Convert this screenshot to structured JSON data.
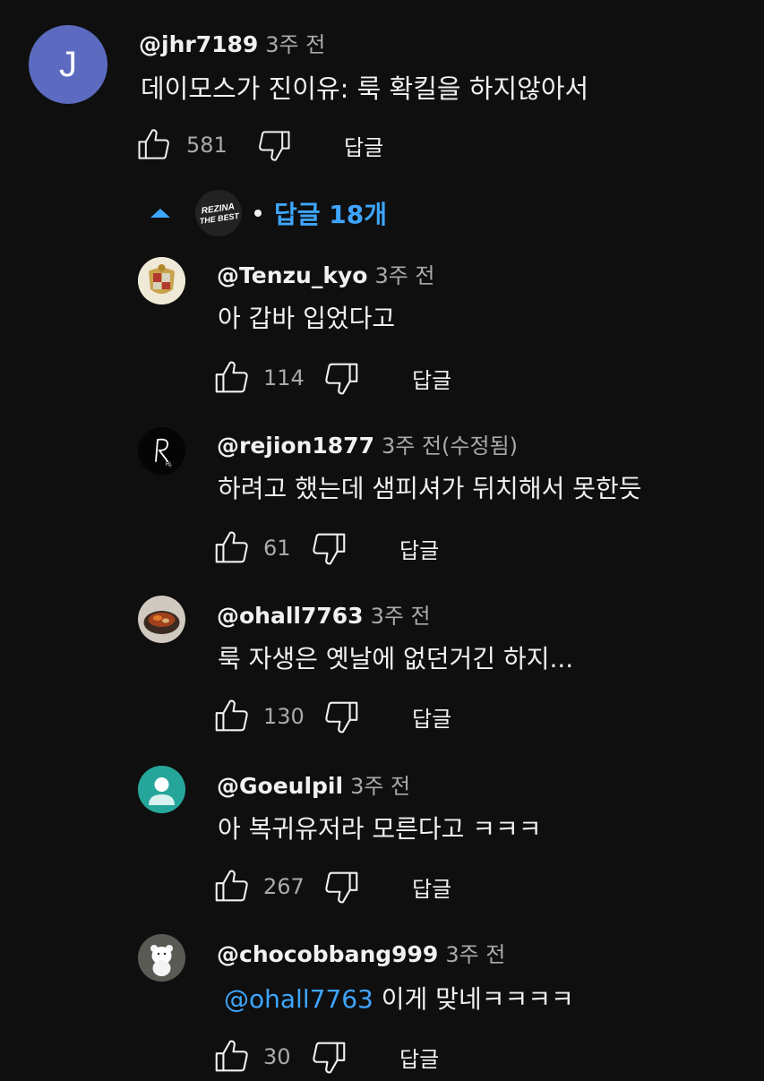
{
  "top_comment": {
    "avatar_letter": "J",
    "avatar_color": "#5c6bc0",
    "handle": "@jhr7189",
    "time": "3주 전",
    "text": "데이모스가 진이유: 룩 확킬을 하지않아서",
    "likes": "581",
    "reply_label": "답글"
  },
  "replies_toggle": {
    "label": "답글 18개",
    "creator_avatar_text": "REZINA THE BEST"
  },
  "replies": [
    {
      "handle": "@Tenzu_kyo",
      "time": "3주 전",
      "text": "아 갑바 입었다고",
      "likes": "114",
      "reply_label": "답글",
      "avatar": "coat-of-arms"
    },
    {
      "handle": "@rejion1877",
      "time": "3주 전(수정됨)",
      "text": "하려고 했는데 샘피셔가 뒤치해서 못한듯",
      "likes": "61",
      "reply_label": "답글",
      "avatar": "letter-r"
    },
    {
      "handle": "@ohall7763",
      "time": "3주 전",
      "text": "룩 자생은 옛날에 없던거긴 하지...",
      "likes": "130",
      "reply_label": "답글",
      "avatar": "food-bowl"
    },
    {
      "handle": "@Goeulpil",
      "time": "3주 전",
      "text": "아 복귀유저라 모른다고 ㅋㅋㅋ",
      "likes": "267",
      "reply_label": "답글",
      "avatar": "default-person"
    },
    {
      "handle": "@chocobbang999",
      "time": "3주 전",
      "mention": "@ohall7763",
      "text": " 이게 맞네ㅋㅋㅋㅋ",
      "likes": "30",
      "reply_label": "답글",
      "avatar": "white-bear"
    }
  ],
  "colors": {
    "background": "#0f0f0f",
    "link": "#3ea6ff",
    "secondary_text": "#aaaaaa"
  }
}
